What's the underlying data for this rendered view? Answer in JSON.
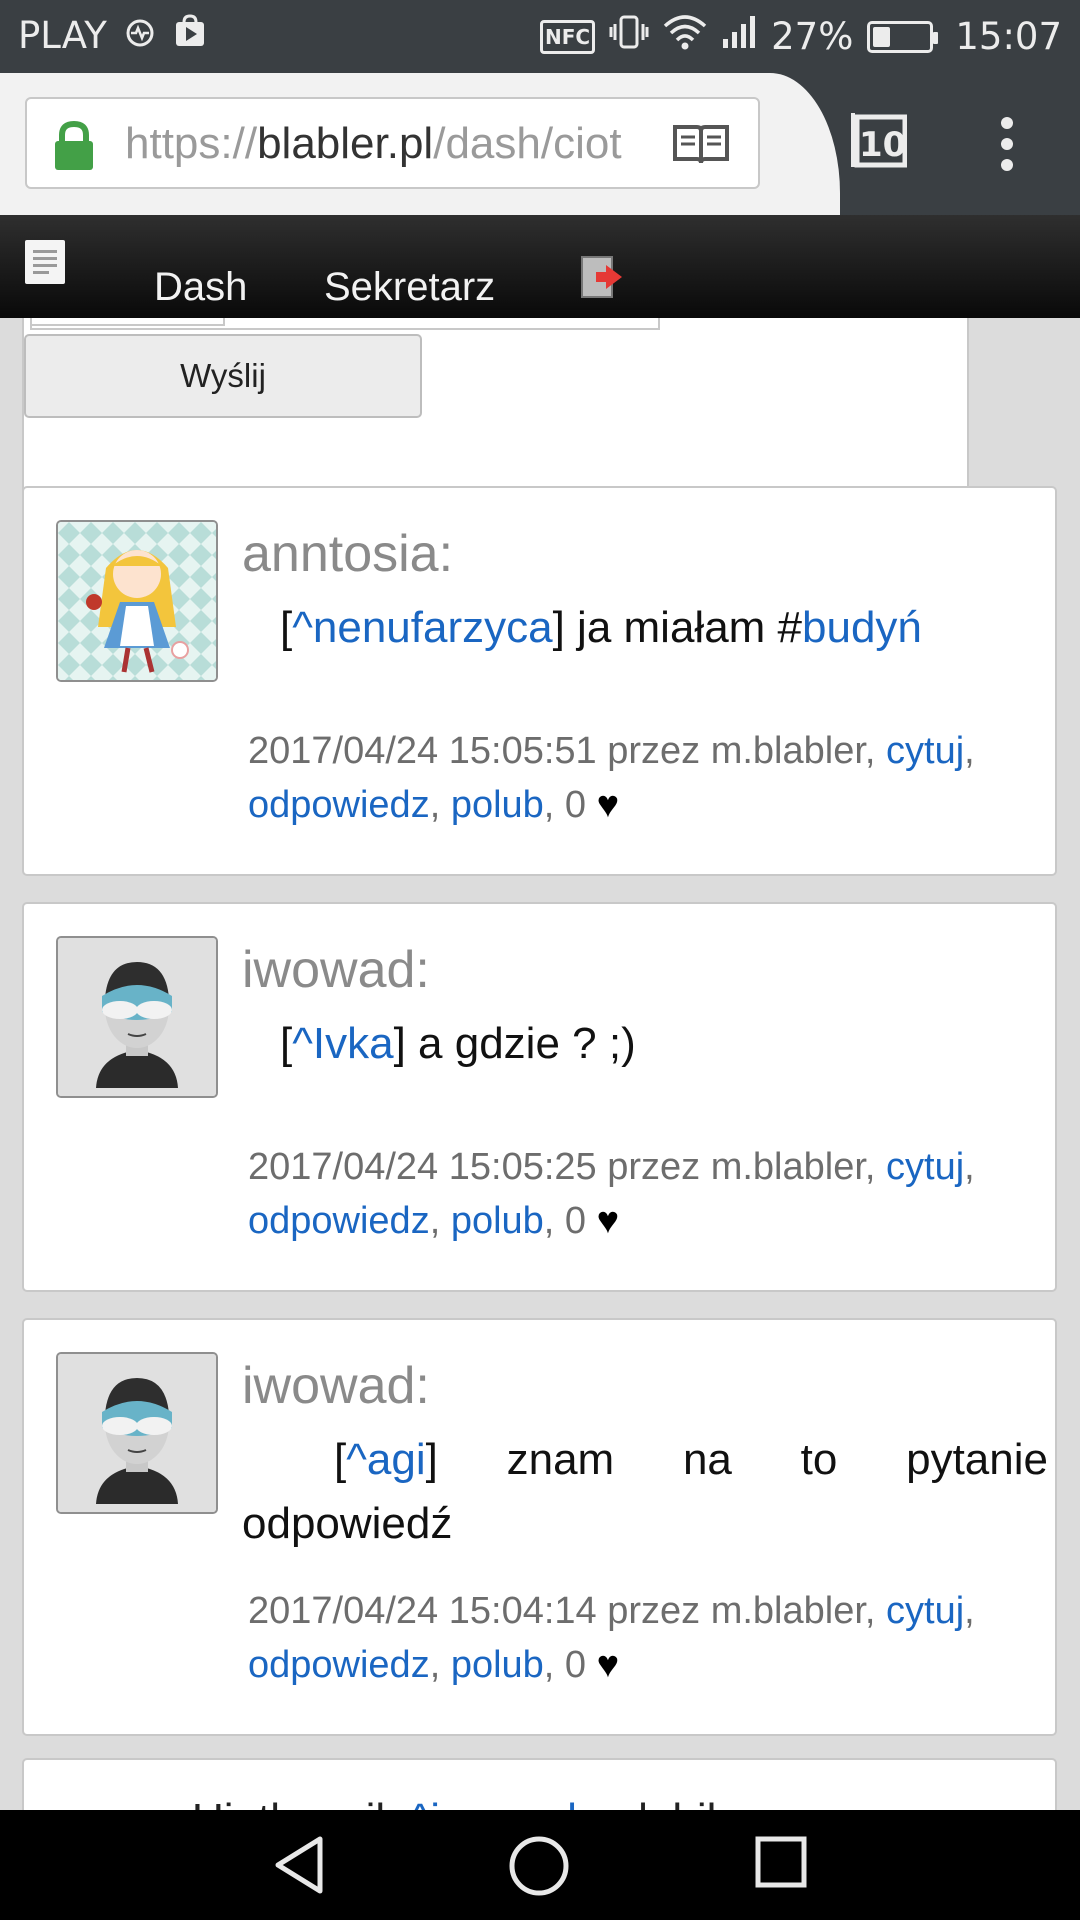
{
  "status_bar": {
    "carrier": "PLAY",
    "nfc": "NFC",
    "battery_percent": "27%",
    "battery_level": 0.27,
    "time": "15:07"
  },
  "browser": {
    "url_scheme": "https://",
    "url_domain": "blabler.pl",
    "url_path": "/dash/ciot",
    "tab_count": "10"
  },
  "site_nav": {
    "items": [
      "Dash",
      "Sekretarz"
    ]
  },
  "form": {
    "send_label": "Wyślij"
  },
  "posts": [
    {
      "author": "anntosia:",
      "mention": "^nenufarzyca",
      "text": " ja miałam #",
      "tag": "budyń",
      "date": "2017/04/24 15:05:51 przez m.blabler, ",
      "quote": "cytuj",
      "reply": "odpowiedz",
      "like": "polub",
      "likes": "0"
    },
    {
      "author": "iwowad:",
      "mention": "^Ivka",
      "text": " a gdzie ? ;)",
      "date": "2017/04/24 15:05:25 przez m.blabler, ",
      "quote": "cytuj",
      "reply": "odpowiedz",
      "like": "polub",
      "likes": "0"
    },
    {
      "author": "iwowad:",
      "mention": "^agi",
      "text": "] znam na to pytanie",
      "text2": "odpowiedź",
      "date": "2017/04/24 15:04:14 przez m.blabler, ",
      "quote": "cytuj",
      "reply": "odpowiedz",
      "like": "polub",
      "likes": "0"
    }
  ],
  "partial_post": {
    "text_start": "Ui, tłumnik ",
    "link": "^iwowad",
    "text_end": " polubił"
  }
}
